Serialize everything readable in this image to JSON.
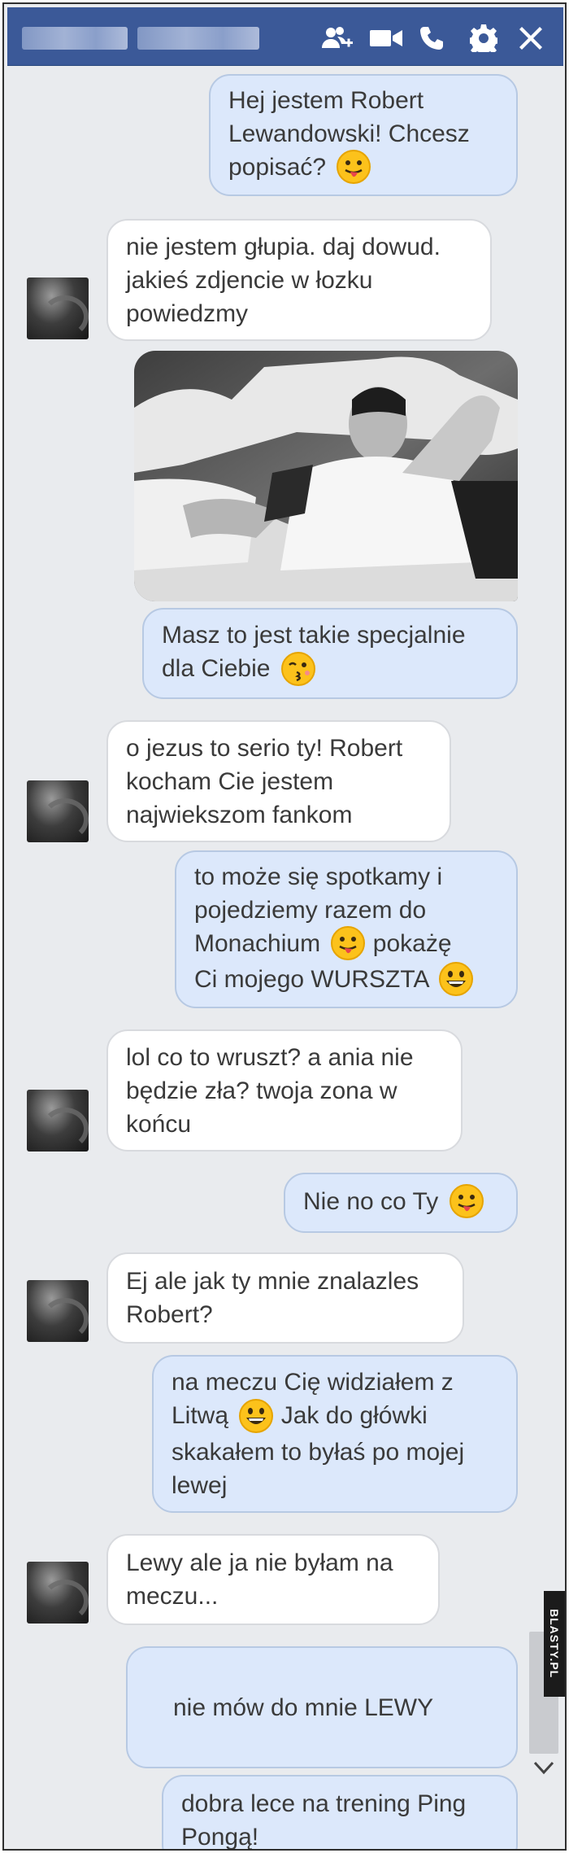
{
  "titlebar": {
    "contact_name_blurred": "",
    "icons": [
      "add-people-icon",
      "video-call-icon",
      "phone-icon",
      "settings-gear-icon",
      "close-icon"
    ],
    "brand_color": "#3b5998"
  },
  "messages": [
    {
      "side": "out",
      "lines": [
        "Hej jestem Robert",
        "Lewandowski! Chcesz",
        "popisać?"
      ],
      "emoji": "tongue-face"
    },
    {
      "side": "in",
      "lines": [
        "nie jestem głupia. daj dowud.",
        "jakieś zdjencie w łozku",
        "powiedzmy"
      ]
    },
    {
      "side": "out",
      "type": "photo",
      "alt": ""
    },
    {
      "side": "out",
      "lines": [
        "Masz to jest takie specjalnie",
        "dla Ciebie"
      ],
      "emoji": "kissing-face"
    },
    {
      "side": "in",
      "lines": [
        "o jezus to serio ty! Robert",
        "kocham Cie jestem",
        "najwiekszom fankom"
      ]
    },
    {
      "side": "out",
      "lines": [
        "to może się spotkamy i",
        "pojedziemy razem do",
        "Monachium",
        "pokażę",
        "Ci mojego WURSZTA"
      ]
    },
    {
      "side": "in",
      "lines": [
        "lol co to wruszt? a ania nie",
        "będzie zła? twoja zona w",
        "końcu"
      ]
    },
    {
      "side": "out",
      "lines": [
        "Nie no co Ty"
      ],
      "emoji": "tongue-face"
    },
    {
      "side": "in",
      "lines": [
        "Ej ale jak ty mnie znalazles",
        "Robert?"
      ]
    },
    {
      "side": "out",
      "lines": [
        "na meczu Cię widziałem z",
        "Litwą",
        "Jak do główki",
        "skakałem to byłaś po mojej",
        "lewej"
      ]
    },
    {
      "side": "in",
      "lines": [
        "Lewy ale ja nie byłam na",
        "meczu..."
      ]
    },
    {
      "side": "out",
      "lines": [
        "nie mów do mnie LEWY"
      ]
    },
    {
      "side": "out",
      "lines": [
        "dobra lece na trening Ping",
        "Pongą!"
      ]
    }
  ],
  "watermark": "BLASTY.PL",
  "colors": {
    "outgoing_bubble": "#dce8fb",
    "incoming_bubble": "#ffffff",
    "chat_bg": "#e9ebee"
  }
}
